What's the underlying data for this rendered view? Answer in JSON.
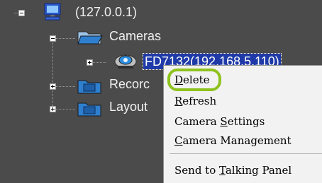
{
  "tree": {
    "server": {
      "label": "(127.0.0.1)",
      "expander": "minus"
    },
    "cameras": {
      "label": "Cameras",
      "expander": "minus"
    },
    "camera_item": {
      "label": "FD7132(192.168.5.110)",
      "expander": "plus"
    },
    "recordings": {
      "label": "Recorc",
      "expander": "plus"
    },
    "layouts": {
      "label": "Layout",
      "expander": "plus"
    }
  },
  "context_menu": {
    "items": [
      {
        "pre": "",
        "mnemonic": "D",
        "post": "elete"
      },
      {
        "pre": "",
        "mnemonic": "R",
        "post": "efresh"
      },
      {
        "pre": "Camera ",
        "mnemonic": "S",
        "post": "ettings"
      },
      {
        "pre": "",
        "mnemonic": "C",
        "post": "amera Management"
      },
      {
        "pre": "Send to ",
        "mnemonic": "T",
        "post": "alking Panel"
      }
    ]
  },
  "colors": {
    "background": "#4b4b4b",
    "selection": "#1f3aa8",
    "highlight_ring": "#8ec21e",
    "menu_background": "#f2f2f2"
  },
  "icons": [
    "computer-icon",
    "folder-open-icon",
    "camera-icon",
    "folder-icon",
    "folder-icon"
  ]
}
